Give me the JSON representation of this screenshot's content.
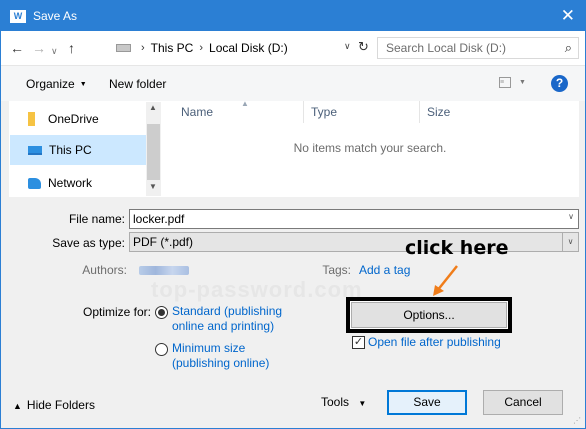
{
  "window": {
    "title": "Save As",
    "app_icon": "word-icon",
    "close_label": "✕"
  },
  "address_bar": {
    "path": [
      "This PC",
      "Local Disk (D:)"
    ],
    "search_placeholder": "Search Local Disk (D:)"
  },
  "toolbar": {
    "organize_label": "Organize",
    "new_folder_label": "New folder",
    "help_label": "?"
  },
  "nav_pane": {
    "items": [
      {
        "label": "OneDrive",
        "icon": "folder-icon",
        "selected": false
      },
      {
        "label": "This PC",
        "icon": "computer-icon",
        "selected": true
      },
      {
        "label": "Network",
        "icon": "network-icon",
        "selected": false
      }
    ]
  },
  "file_list": {
    "columns": [
      "Name",
      "Type",
      "Size"
    ],
    "empty_message": "No items match your search."
  },
  "form": {
    "file_name_label": "File name:",
    "file_name_value": "locker.pdf",
    "save_as_type_label": "Save as type:",
    "save_as_type_value": "PDF (*.pdf)",
    "authors_label": "Authors:",
    "tags_label": "Tags:",
    "tags_link": "Add a tag",
    "optimize_label": "Optimize for:",
    "optimize_options": [
      {
        "line1": "Standard (publishing",
        "line2": "online and printing)",
        "selected": true
      },
      {
        "line1": "Minimum size",
        "line2": "(publishing online)",
        "selected": false
      }
    ],
    "open_after_label": "Open file after publishing",
    "open_after_checked": true,
    "options_button": "Options..."
  },
  "footer": {
    "hide_folders": "Hide Folders",
    "tools_label": "Tools",
    "save_label": "Save",
    "cancel_label": "Cancel"
  },
  "annotations": {
    "callout_text": "click here",
    "watermark_text": "top-password.com",
    "arrow_color": "#f07d1a"
  }
}
